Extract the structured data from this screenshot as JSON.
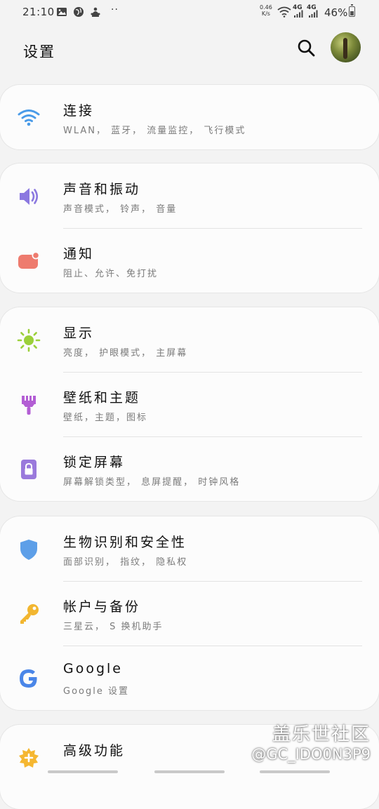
{
  "status_bar": {
    "time": "21:10",
    "net_speed_value": "0.46",
    "net_speed_unit": "K/s",
    "network_1": "4G",
    "network_2": "4G",
    "battery": "46%"
  },
  "header": {
    "title": "设置"
  },
  "groups": [
    {
      "items": [
        {
          "icon": "wifi-icon",
          "label": "连接",
          "sub": "WLAN， 蓝牙， 流量监控， 飞行模式",
          "color": "#4a9be8"
        }
      ]
    },
    {
      "items": [
        {
          "icon": "volume-icon",
          "label": "声音和振动",
          "sub": "声音模式， 铃声， 音量",
          "color": "#8b78e0"
        },
        {
          "icon": "notification-icon",
          "label": "通知",
          "sub": "阻止、允许、免打扰",
          "color": "#ee7b6e"
        }
      ]
    },
    {
      "items": [
        {
          "icon": "brightness-icon",
          "label": "显示",
          "sub": "亮度， 护眼模式， 主屏幕",
          "color": "#9bd03a"
        },
        {
          "icon": "paint-brush-icon",
          "label": "壁纸和主题",
          "sub": "壁纸，主题，图标",
          "color": "#b35ed4"
        },
        {
          "icon": "lock-icon",
          "label": "锁定屏幕",
          "sub": "屏幕解锁类型， 息屏提醒， 时钟风格",
          "color": "#9a79dc"
        }
      ]
    },
    {
      "items": [
        {
          "icon": "shield-icon",
          "label": "生物识别和安全性",
          "sub": "面部识别， 指纹， 隐私权",
          "color": "#5d9fe8"
        },
        {
          "icon": "key-icon",
          "label": "帐户与备份",
          "sub": "三星云， S 换机助手",
          "color": "#f2b630"
        },
        {
          "icon": "google-icon",
          "label": "Google",
          "sub": "Google 设置",
          "color": "#4a86e8"
        }
      ]
    },
    {
      "items": [
        {
          "icon": "advanced-features-icon",
          "label": "高级功能",
          "sub": "",
          "color": "#f5b731"
        }
      ]
    }
  ],
  "watermark": {
    "brand": "盖乐世社区",
    "handle": "@GC_IDO0N3P9"
  }
}
